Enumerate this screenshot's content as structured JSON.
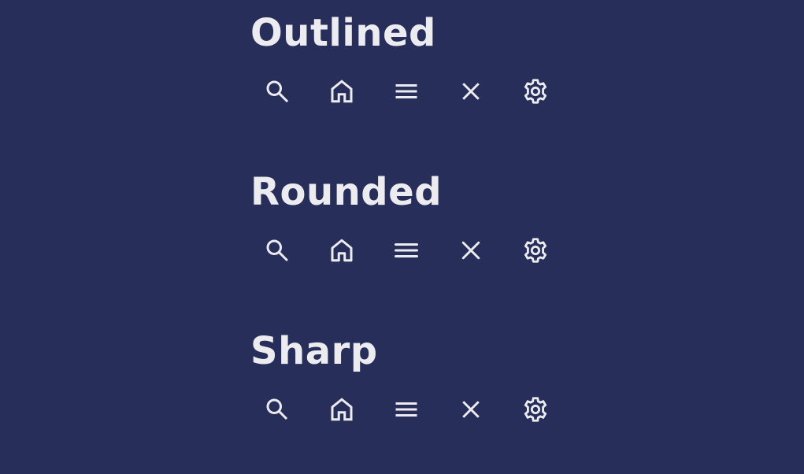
{
  "theme": {
    "background": "#272e5a",
    "foreground": "#ecebef"
  },
  "sections": [
    {
      "title": "Outlined",
      "icons": [
        "search-icon",
        "home-icon",
        "menu-icon",
        "close-icon",
        "settings-icon"
      ]
    },
    {
      "title": "Rounded",
      "icons": [
        "search-icon",
        "home-icon",
        "menu-icon",
        "close-icon",
        "settings-icon"
      ]
    },
    {
      "title": "Sharp",
      "icons": [
        "search-icon",
        "home-icon",
        "menu-icon",
        "close-icon",
        "settings-icon"
      ]
    }
  ]
}
